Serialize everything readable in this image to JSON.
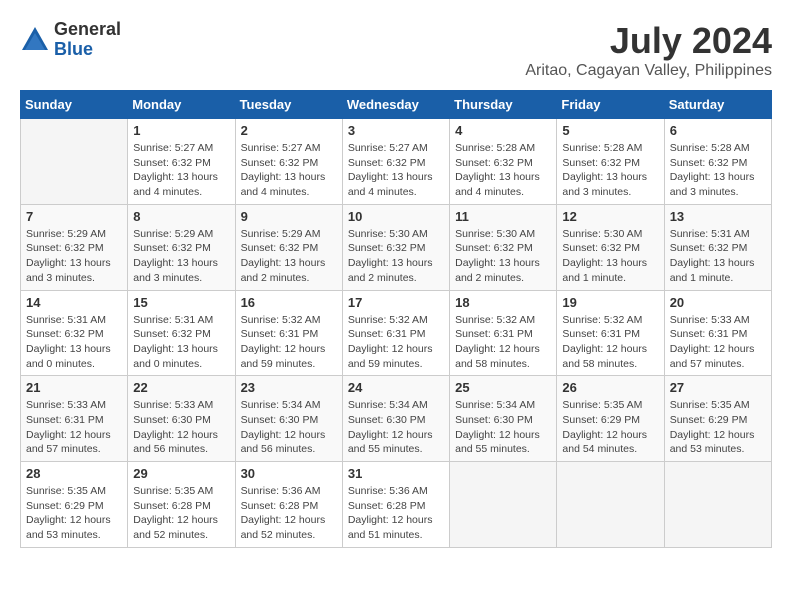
{
  "header": {
    "logo": {
      "general": "General",
      "blue": "Blue"
    },
    "title": "July 2024",
    "location": "Aritao, Cagayan Valley, Philippines"
  },
  "weekdays": [
    "Sunday",
    "Monday",
    "Tuesday",
    "Wednesday",
    "Thursday",
    "Friday",
    "Saturday"
  ],
  "weeks": [
    [
      {
        "day": "",
        "info": ""
      },
      {
        "day": "1",
        "info": "Sunrise: 5:27 AM\nSunset: 6:32 PM\nDaylight: 13 hours\nand 4 minutes."
      },
      {
        "day": "2",
        "info": "Sunrise: 5:27 AM\nSunset: 6:32 PM\nDaylight: 13 hours\nand 4 minutes."
      },
      {
        "day": "3",
        "info": "Sunrise: 5:27 AM\nSunset: 6:32 PM\nDaylight: 13 hours\nand 4 minutes."
      },
      {
        "day": "4",
        "info": "Sunrise: 5:28 AM\nSunset: 6:32 PM\nDaylight: 13 hours\nand 4 minutes."
      },
      {
        "day": "5",
        "info": "Sunrise: 5:28 AM\nSunset: 6:32 PM\nDaylight: 13 hours\nand 3 minutes."
      },
      {
        "day": "6",
        "info": "Sunrise: 5:28 AM\nSunset: 6:32 PM\nDaylight: 13 hours\nand 3 minutes."
      }
    ],
    [
      {
        "day": "7",
        "info": "Sunrise: 5:29 AM\nSunset: 6:32 PM\nDaylight: 13 hours\nand 3 minutes."
      },
      {
        "day": "8",
        "info": "Sunrise: 5:29 AM\nSunset: 6:32 PM\nDaylight: 13 hours\nand 3 minutes."
      },
      {
        "day": "9",
        "info": "Sunrise: 5:29 AM\nSunset: 6:32 PM\nDaylight: 13 hours\nand 2 minutes."
      },
      {
        "day": "10",
        "info": "Sunrise: 5:30 AM\nSunset: 6:32 PM\nDaylight: 13 hours\nand 2 minutes."
      },
      {
        "day": "11",
        "info": "Sunrise: 5:30 AM\nSunset: 6:32 PM\nDaylight: 13 hours\nand 2 minutes."
      },
      {
        "day": "12",
        "info": "Sunrise: 5:30 AM\nSunset: 6:32 PM\nDaylight: 13 hours\nand 1 minute."
      },
      {
        "day": "13",
        "info": "Sunrise: 5:31 AM\nSunset: 6:32 PM\nDaylight: 13 hours\nand 1 minute."
      }
    ],
    [
      {
        "day": "14",
        "info": "Sunrise: 5:31 AM\nSunset: 6:32 PM\nDaylight: 13 hours\nand 0 minutes."
      },
      {
        "day": "15",
        "info": "Sunrise: 5:31 AM\nSunset: 6:32 PM\nDaylight: 13 hours\nand 0 minutes."
      },
      {
        "day": "16",
        "info": "Sunrise: 5:32 AM\nSunset: 6:31 PM\nDaylight: 12 hours\nand 59 minutes."
      },
      {
        "day": "17",
        "info": "Sunrise: 5:32 AM\nSunset: 6:31 PM\nDaylight: 12 hours\nand 59 minutes."
      },
      {
        "day": "18",
        "info": "Sunrise: 5:32 AM\nSunset: 6:31 PM\nDaylight: 12 hours\nand 58 minutes."
      },
      {
        "day": "19",
        "info": "Sunrise: 5:32 AM\nSunset: 6:31 PM\nDaylight: 12 hours\nand 58 minutes."
      },
      {
        "day": "20",
        "info": "Sunrise: 5:33 AM\nSunset: 6:31 PM\nDaylight: 12 hours\nand 57 minutes."
      }
    ],
    [
      {
        "day": "21",
        "info": "Sunrise: 5:33 AM\nSunset: 6:31 PM\nDaylight: 12 hours\nand 57 minutes."
      },
      {
        "day": "22",
        "info": "Sunrise: 5:33 AM\nSunset: 6:30 PM\nDaylight: 12 hours\nand 56 minutes."
      },
      {
        "day": "23",
        "info": "Sunrise: 5:34 AM\nSunset: 6:30 PM\nDaylight: 12 hours\nand 56 minutes."
      },
      {
        "day": "24",
        "info": "Sunrise: 5:34 AM\nSunset: 6:30 PM\nDaylight: 12 hours\nand 55 minutes."
      },
      {
        "day": "25",
        "info": "Sunrise: 5:34 AM\nSunset: 6:30 PM\nDaylight: 12 hours\nand 55 minutes."
      },
      {
        "day": "26",
        "info": "Sunrise: 5:35 AM\nSunset: 6:29 PM\nDaylight: 12 hours\nand 54 minutes."
      },
      {
        "day": "27",
        "info": "Sunrise: 5:35 AM\nSunset: 6:29 PM\nDaylight: 12 hours\nand 53 minutes."
      }
    ],
    [
      {
        "day": "28",
        "info": "Sunrise: 5:35 AM\nSunset: 6:29 PM\nDaylight: 12 hours\nand 53 minutes."
      },
      {
        "day": "29",
        "info": "Sunrise: 5:35 AM\nSunset: 6:28 PM\nDaylight: 12 hours\nand 52 minutes."
      },
      {
        "day": "30",
        "info": "Sunrise: 5:36 AM\nSunset: 6:28 PM\nDaylight: 12 hours\nand 52 minutes."
      },
      {
        "day": "31",
        "info": "Sunrise: 5:36 AM\nSunset: 6:28 PM\nDaylight: 12 hours\nand 51 minutes."
      },
      {
        "day": "",
        "info": ""
      },
      {
        "day": "",
        "info": ""
      },
      {
        "day": "",
        "info": ""
      }
    ]
  ]
}
